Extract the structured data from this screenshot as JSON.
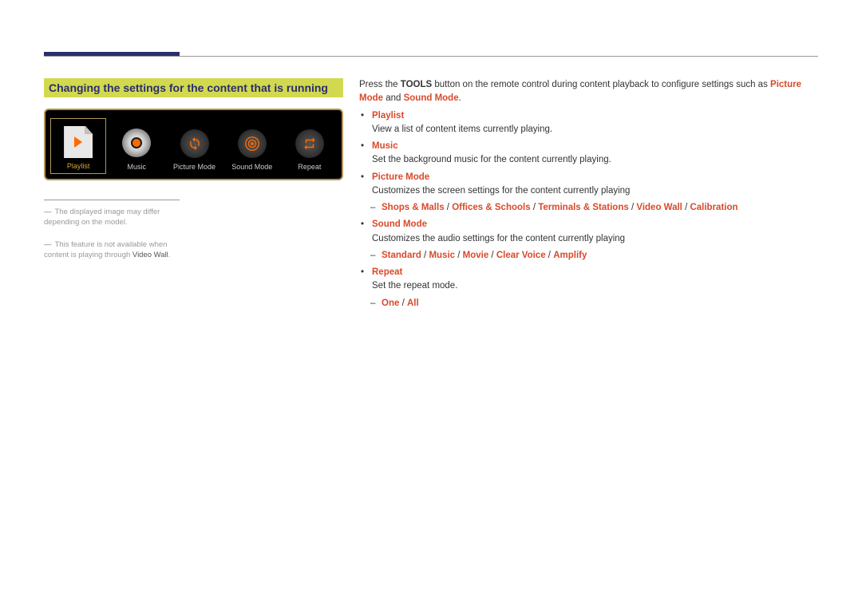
{
  "section_title": "Changing the settings for the content that is running",
  "tools_panel": {
    "items": [
      {
        "label": "Playlist",
        "selected": true,
        "icon": "playlist"
      },
      {
        "label": "Music",
        "selected": false,
        "icon": "disc"
      },
      {
        "label": "Picture Mode",
        "selected": false,
        "icon": "refresh"
      },
      {
        "label": "Sound Mode",
        "selected": false,
        "icon": "sound"
      },
      {
        "label": "Repeat",
        "selected": false,
        "icon": "repeat"
      }
    ]
  },
  "notes": {
    "line1": "The displayed image may differ depending on the model.",
    "line2_a": "This feature is not available when content is playing through ",
    "line2_b": "Video Wall",
    "line2_c": "."
  },
  "intro": {
    "part1": "Press the ",
    "tools": "TOOLS",
    "part2": " button on the remote control during content playback to configure settings such as ",
    "pm": "Picture Mode",
    "part3": " and ",
    "sm": "Sound Mode",
    "part4": "."
  },
  "items": {
    "playlist": {
      "title": "Playlist",
      "desc": "View a list of content items currently playing."
    },
    "music": {
      "title": "Music",
      "desc": "Set the background music for the content currently playing."
    },
    "picture_mode": {
      "title": "Picture Mode",
      "desc": "Customizes the screen settings for the content currently playing",
      "opts": [
        "Shops & Malls",
        "Offices & Schools",
        "Terminals & Stations",
        "Video Wall",
        "Calibration"
      ]
    },
    "sound_mode": {
      "title": "Sound Mode",
      "desc": "Customizes the audio settings for the content currently playing",
      "opts": [
        "Standard",
        "Music",
        "Movie",
        "Clear Voice",
        "Amplify"
      ]
    },
    "repeat": {
      "title": "Repeat",
      "desc": "Set the repeat mode.",
      "opts": [
        "One",
        "All"
      ]
    }
  }
}
